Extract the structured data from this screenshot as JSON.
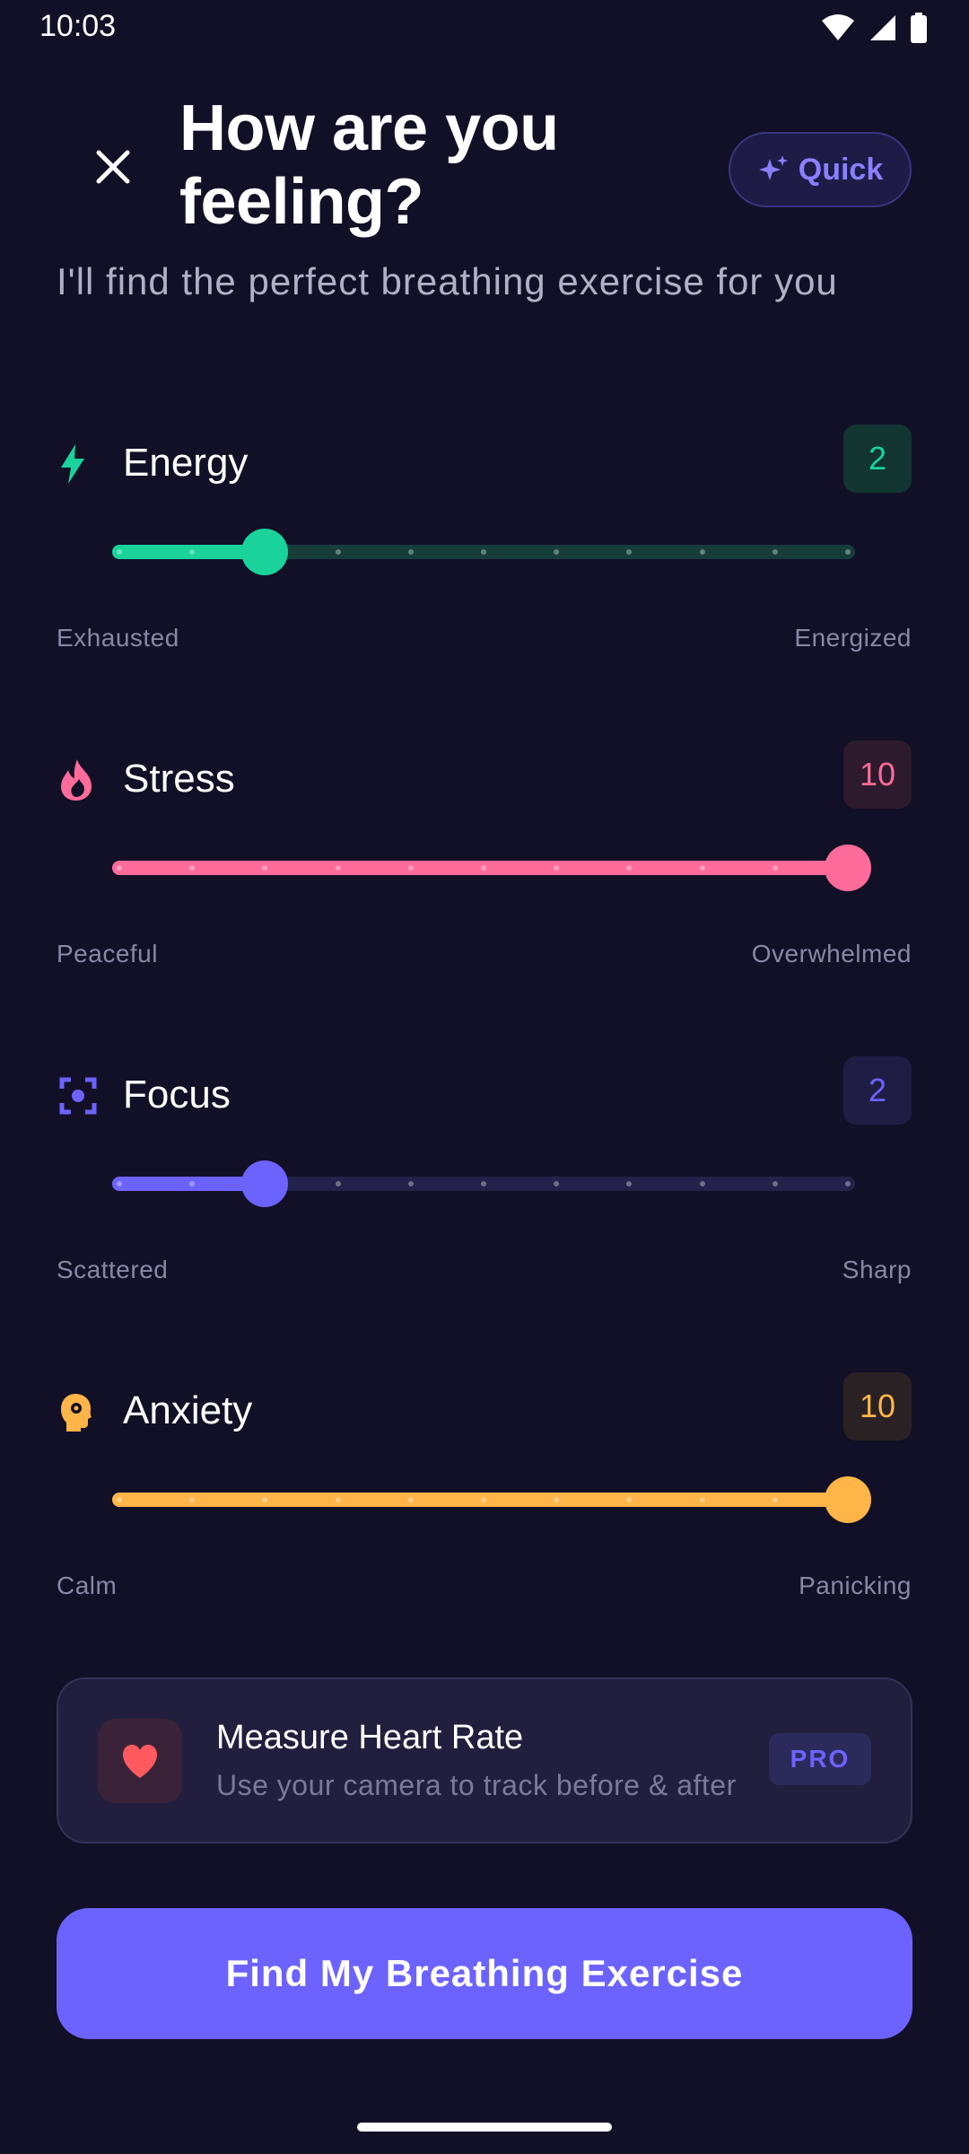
{
  "status_bar": {
    "time": "10:03"
  },
  "header": {
    "title": "How are you feeling?",
    "quick_label": "Quick",
    "subtitle": "I'll find the perfect breathing exercise for you"
  },
  "metrics": [
    {
      "label": "Energy",
      "value": "2",
      "min_label": "Exhausted",
      "max_label": "Energized",
      "level": 2,
      "max": 10,
      "accent": "#19d39b",
      "track_bg": "#163d3a",
      "badge_bg": "#123532",
      "icon": "bolt-icon"
    },
    {
      "label": "Stress",
      "value": "10",
      "min_label": "Peaceful",
      "max_label": "Overwhelmed",
      "level": 10,
      "max": 10,
      "accent": "#ff6b9a",
      "track_bg": "#3b1f36",
      "badge_bg": "#2d1a2c",
      "icon": "flame-icon"
    },
    {
      "label": "Focus",
      "value": "2",
      "min_label": "Scattered",
      "max_label": "Sharp",
      "level": 2,
      "max": 10,
      "accent": "#6c63ff",
      "track_bg": "#24214a",
      "badge_bg": "#201d45",
      "icon": "focus-target-icon"
    },
    {
      "label": "Anxiety",
      "value": "10",
      "min_label": "Calm",
      "max_label": "Panicking",
      "level": 10,
      "max": 10,
      "accent": "#ffb547",
      "track_bg": "#3a2d24",
      "badge_bg": "#2a2124",
      "icon": "head-gear-icon"
    }
  ],
  "heart_rate_card": {
    "title": "Measure Heart Rate",
    "subtitle": "Use your camera to track before & after",
    "badge": "PRO",
    "icon": "heart-icon"
  },
  "cta": {
    "label": "Find My Breathing Exercise"
  }
}
